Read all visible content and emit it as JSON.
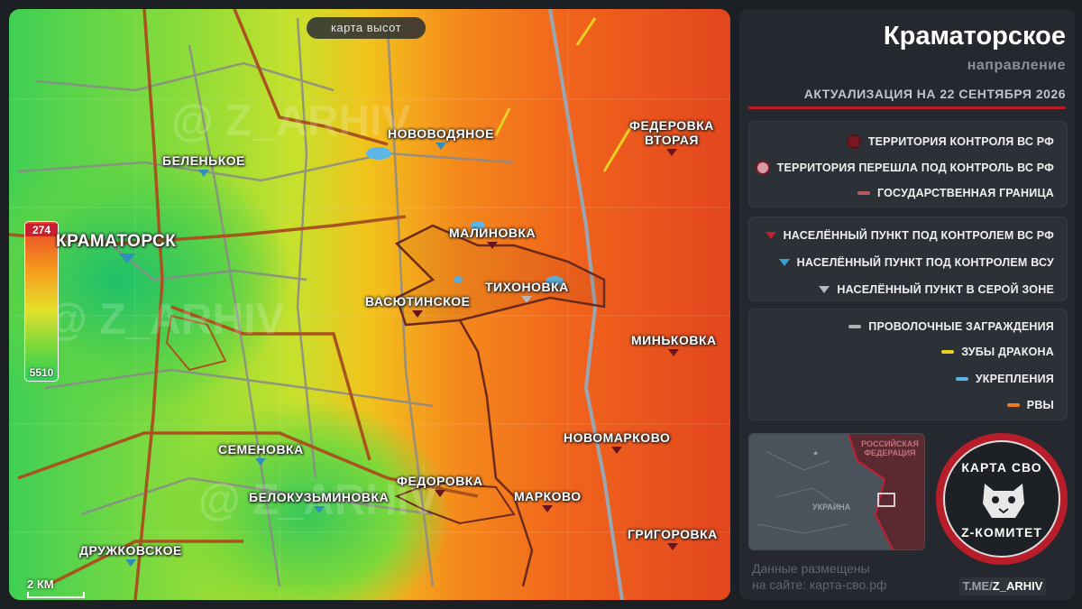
{
  "map": {
    "badge": "карта высот",
    "elevation": {
      "top": "274",
      "bottom": "5510"
    },
    "scale": "2 КМ",
    "places": [
      {
        "name": "КРАМАТОРСК",
        "status": "ua",
        "big": true
      },
      {
        "name": "БЕЛЕНЬКОЕ",
        "status": "ua"
      },
      {
        "name": "НОВОВОДЯНОЕ",
        "status": "ua"
      },
      {
        "name": "ФЕДЕРОВКА",
        "line2": "ВТОРАЯ",
        "status": "ru"
      },
      {
        "name": "МАЛИНОВКА",
        "status": "ru"
      },
      {
        "name": "ТИХОНОВКА",
        "status": "gray"
      },
      {
        "name": "ВАСЮТИНСКОЕ",
        "status": "ru"
      },
      {
        "name": "МИНЬКОВКА",
        "status": "ru"
      },
      {
        "name": "СЕМЕНОВКА",
        "status": "ua"
      },
      {
        "name": "ФЕДОРОВКА",
        "status": "ru"
      },
      {
        "name": "НОВОМАРКОВО",
        "status": "ru"
      },
      {
        "name": "БЕЛОКУЗЬМИНОВКА",
        "status": "ua"
      },
      {
        "name": "МАРКОВО",
        "status": "ru"
      },
      {
        "name": "ДРУЖКОВСКОЕ",
        "status": "ua"
      },
      {
        "name": "ГРИГОРОВКА",
        "status": "ru"
      }
    ]
  },
  "header": {
    "title": "Краматорское",
    "subtitle": "направление",
    "update": "АКТУАЛИЗАЦИЯ НА 22 СЕНТЯБРЯ 2026"
  },
  "legend": {
    "territory": [
      {
        "label": "ТЕРРИТОРИЯ КОНТРОЛЯ ВС РФ",
        "color": "#7a1a22"
      },
      {
        "label": "ТЕРРИТОРИЯ ПЕРЕШЛА ПОД КОНТРОЛЬ ВС РФ",
        "color": "#d99aa8"
      },
      {
        "label": "ГОСУДАРСТВЕННАЯ ГРАНИЦА",
        "color": "#b55a60"
      }
    ],
    "settlements": [
      {
        "label": "НАСЕЛЁННЫЙ ПУНКТ ПОД КОНТРОЛЕМ ВС РФ",
        "color": "#c02030"
      },
      {
        "label": "НАСЕЛЁННЫЙ ПУНКТ ПОД КОНТРОЛЕМ ВСУ",
        "color": "#3a9fd0"
      },
      {
        "label": "НАСЕЛЁННЫЙ ПУНКТ В СЕРОЙ ЗОНЕ",
        "color": "#b8b8b8"
      }
    ],
    "fortifications": [
      {
        "label": "ПРОВОЛОЧНЫЕ ЗАГРАЖДЕНИЯ",
        "color": "#b0b0b0"
      },
      {
        "label": "ЗУБЫ ДРАКОНА",
        "color": "#e8d020"
      },
      {
        "label": "УКРЕПЛЕНИЯ",
        "color": "#5ab4e8"
      },
      {
        "label": "РВЫ",
        "color": "#f07a1c"
      }
    ]
  },
  "inset": {
    "russia": "РОССИЙСКАЯ ФЕДЕРАЦИЯ",
    "ukraine": "УКРАИНА"
  },
  "credit": {
    "line1": "Данные размещены",
    "line2": "на сайте: карта-сво.рф"
  },
  "emblem": {
    "top": "КАРТА СВО",
    "bottom": "Z-КОМИТЕТ"
  },
  "channel": {
    "prefix": "T.ME/",
    "name": "Z_ARHIV"
  }
}
